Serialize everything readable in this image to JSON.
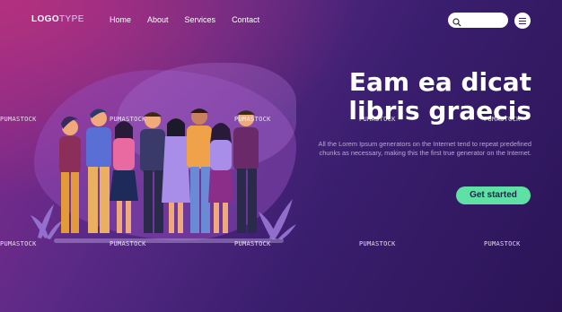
{
  "logo": {
    "bold": "LOGO",
    "light": "TYPE"
  },
  "nav": {
    "items": [
      "Home",
      "About",
      "Services",
      "Contact"
    ]
  },
  "search": {
    "placeholder": ""
  },
  "hero": {
    "title": "Eam ea dicat libris graecis",
    "body": "All the Lorem Ipsum generators on the Internet tend to repeat predefined chunks as necessary, making this the first true generator on the Internet.",
    "cta": "Get started"
  },
  "watermark": "PUMASTOCK",
  "colors": {
    "accent": "#5fe0a4",
    "bg_dark": "#2b1456",
    "bg_pink": "#b3317e"
  },
  "icons": [
    "search-icon",
    "hamburger-menu-icon"
  ]
}
